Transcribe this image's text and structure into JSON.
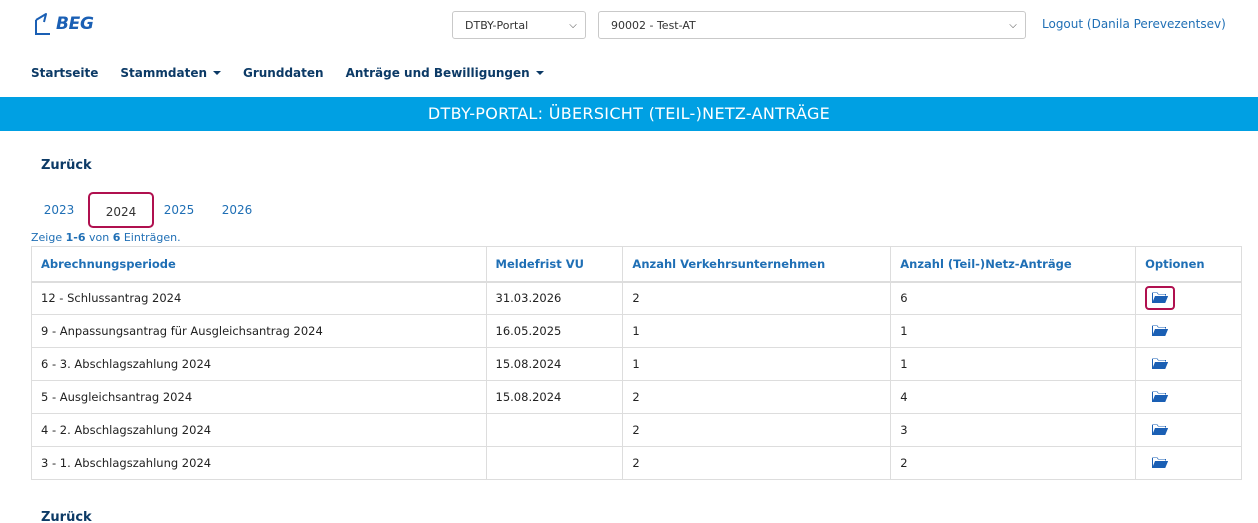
{
  "header": {
    "logo_text": "BEG",
    "portal_select": "DTBY-Portal",
    "company_select": "90002 - Test-AT",
    "logout_label": "Logout (Danila Perevezentsev)"
  },
  "nav": {
    "home": "Startseite",
    "masterdata": "Stammdaten",
    "basedata": "Grunddaten",
    "applications": "Anträge und Bewilligungen"
  },
  "banner": {
    "title": "DTBY-PORTAL: ÜBERSICHT (TEIL-)NETZ-ANTRÄGE"
  },
  "back_label": "Zurück",
  "year_tabs": [
    {
      "label": "2023",
      "active": false
    },
    {
      "label": "2024",
      "active": true
    },
    {
      "label": "2025",
      "active": false
    },
    {
      "label": "2026",
      "active": false
    }
  ],
  "summary": {
    "prefix": "Zeige ",
    "range": "1-6",
    "middle": " von ",
    "total": "6",
    "suffix": " Einträgen."
  },
  "table": {
    "headers": [
      "Abrechnungsperiode",
      "Meldefrist VU",
      "Anzahl Verkehrsunternehmen",
      "Anzahl (Teil-)Netz-Anträge",
      "Optionen"
    ],
    "rows": [
      {
        "period": "12 - Schlussantrag 2024",
        "deadline": "31.03.2026",
        "vu_count": "2",
        "netz_count": "6",
        "option_icon": "folder-open-icon"
      },
      {
        "period": "9 - Anpassungsantrag für Ausgleichsantrag 2024",
        "deadline": "16.05.2025",
        "vu_count": "1",
        "netz_count": "1",
        "option_icon": "folder-open-icon"
      },
      {
        "period": "6 - 3. Abschlagszahlung 2024",
        "deadline": "15.08.2024",
        "vu_count": "1",
        "netz_count": "1",
        "option_icon": "folder-open-icon"
      },
      {
        "period": "5 - Ausgleichsantrag 2024",
        "deadline": "15.08.2024",
        "vu_count": "2",
        "netz_count": "4",
        "option_icon": "folder-open-icon"
      },
      {
        "period": "4 - 2. Abschlagszahlung 2024",
        "deadline": "",
        "vu_count": "2",
        "netz_count": "3",
        "option_icon": "folder-open-icon"
      },
      {
        "period": "3 - 1. Abschlagszahlung 2024",
        "deadline": "",
        "vu_count": "2",
        "netz_count": "2",
        "option_icon": "folder-open-icon"
      }
    ]
  },
  "colors": {
    "brand_blue": "#1a5fb4",
    "banner_blue": "#00a0e3",
    "link_blue": "#1f6fb5",
    "nav_navy": "#0c3a66",
    "highlight_red": "#b0104f"
  }
}
